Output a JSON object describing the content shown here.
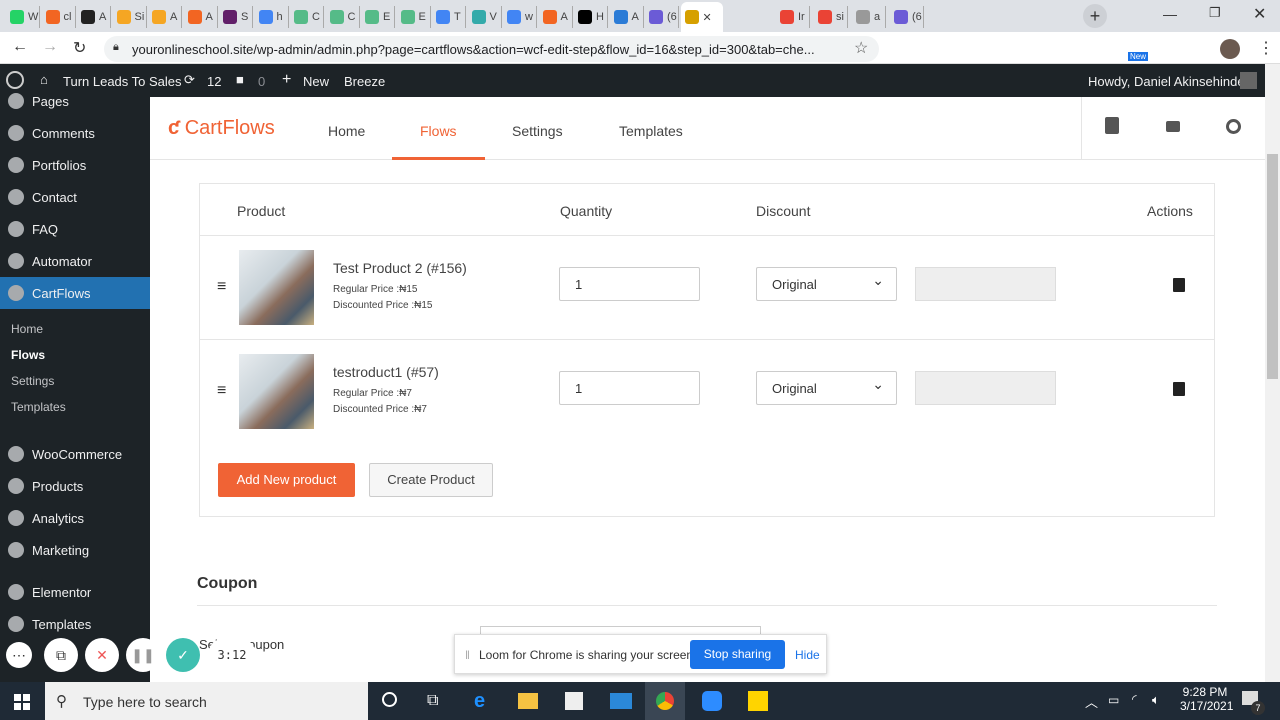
{
  "browser": {
    "tabs": [
      {
        "letter": "W",
        "color": "#25d366"
      },
      {
        "letter": "cl",
        "color": "#f26522"
      },
      {
        "letter": "A",
        "color": "#222"
      },
      {
        "letter": "Si",
        "color": "#f5a623"
      },
      {
        "letter": "A",
        "color": "#f5a623"
      },
      {
        "letter": "A",
        "color": "#f26522"
      },
      {
        "letter": "S",
        "color": "#611f69"
      },
      {
        "letter": "h",
        "color": "#4285f4"
      },
      {
        "letter": "C",
        "color": "#5b8"
      },
      {
        "letter": "C",
        "color": "#5b8"
      },
      {
        "letter": "E",
        "color": "#5b8"
      },
      {
        "letter": "E",
        "color": "#5b8"
      },
      {
        "letter": "T",
        "color": "#4285f4"
      },
      {
        "letter": "V",
        "color": "#3aa"
      },
      {
        "letter": "w",
        "color": "#4285f4"
      },
      {
        "letter": "A",
        "color": "#f26522"
      },
      {
        "letter": "H",
        "color": "#000"
      },
      {
        "letter": "A",
        "color": "#2b7bd6"
      },
      {
        "letter": "(6",
        "color": "#6b5bd6"
      },
      {
        "letter": "✕",
        "color": "#d6a000"
      },
      {
        "letter": "Ir",
        "color": "#ea4335"
      },
      {
        "letter": "si",
        "color": "#ea4335"
      },
      {
        "letter": "a",
        "color": "#999"
      },
      {
        "letter": "(6",
        "color": "#6b5bd6"
      }
    ],
    "new_tab": "+",
    "url": "youronlineschool.site/wp-admin/admin.php?page=cartflows&action=wcf-edit-step&flow_id=16&step_id=300&tab=che...",
    "ext_new_badge": "New"
  },
  "wpbar": {
    "site": "Turn Leads To Sales",
    "updates": "12",
    "comments": "0",
    "new": "New",
    "breeze": "Breeze",
    "howdy": "Howdy, Daniel Akinsehinde"
  },
  "sidebar": {
    "items": [
      "Pages",
      "Comments",
      "Portfolios",
      "Contact",
      "FAQ",
      "Automator",
      "CartFlows",
      "WooCommerce",
      "Products",
      "Analytics",
      "Marketing",
      "Elementor",
      "Templates"
    ],
    "sub": [
      "Home",
      "Flows",
      "Settings",
      "Templates"
    ]
  },
  "cartflows": {
    "logo": "CartFlows",
    "nav": [
      "Home",
      "Flows",
      "Settings",
      "Templates"
    ]
  },
  "table": {
    "headers": [
      "Product",
      "Quantity",
      "Discount",
      "Actions"
    ],
    "rows": [
      {
        "name": "Test Product 2 (#156)",
        "regular": "Regular Price :₦15",
        "discounted": "Discounted Price :₦15",
        "qty": "1",
        "discount": "Original"
      },
      {
        "name": "testroduct1 (#57)",
        "regular": "Regular Price :₦7",
        "discounted": "Discounted Price :₦7",
        "qty": "1",
        "discount": "Original"
      }
    ],
    "add_button": "Add New product",
    "create_button": "Create Product"
  },
  "coupon": {
    "heading": "Coupon",
    "label": "Select Coupon"
  },
  "loom": {
    "message": "Loom for Chrome is sharing your screen.",
    "stop": "Stop sharing",
    "hide": "Hide",
    "timer": "3:12"
  },
  "taskbar": {
    "search": "Type here to search",
    "time": "9:28 PM",
    "date": "3/17/2021",
    "notifications": "7"
  },
  "colors": {
    "accent": "#f06335",
    "wp_blue": "#2271b1",
    "loom_blue": "#1a73e8"
  }
}
